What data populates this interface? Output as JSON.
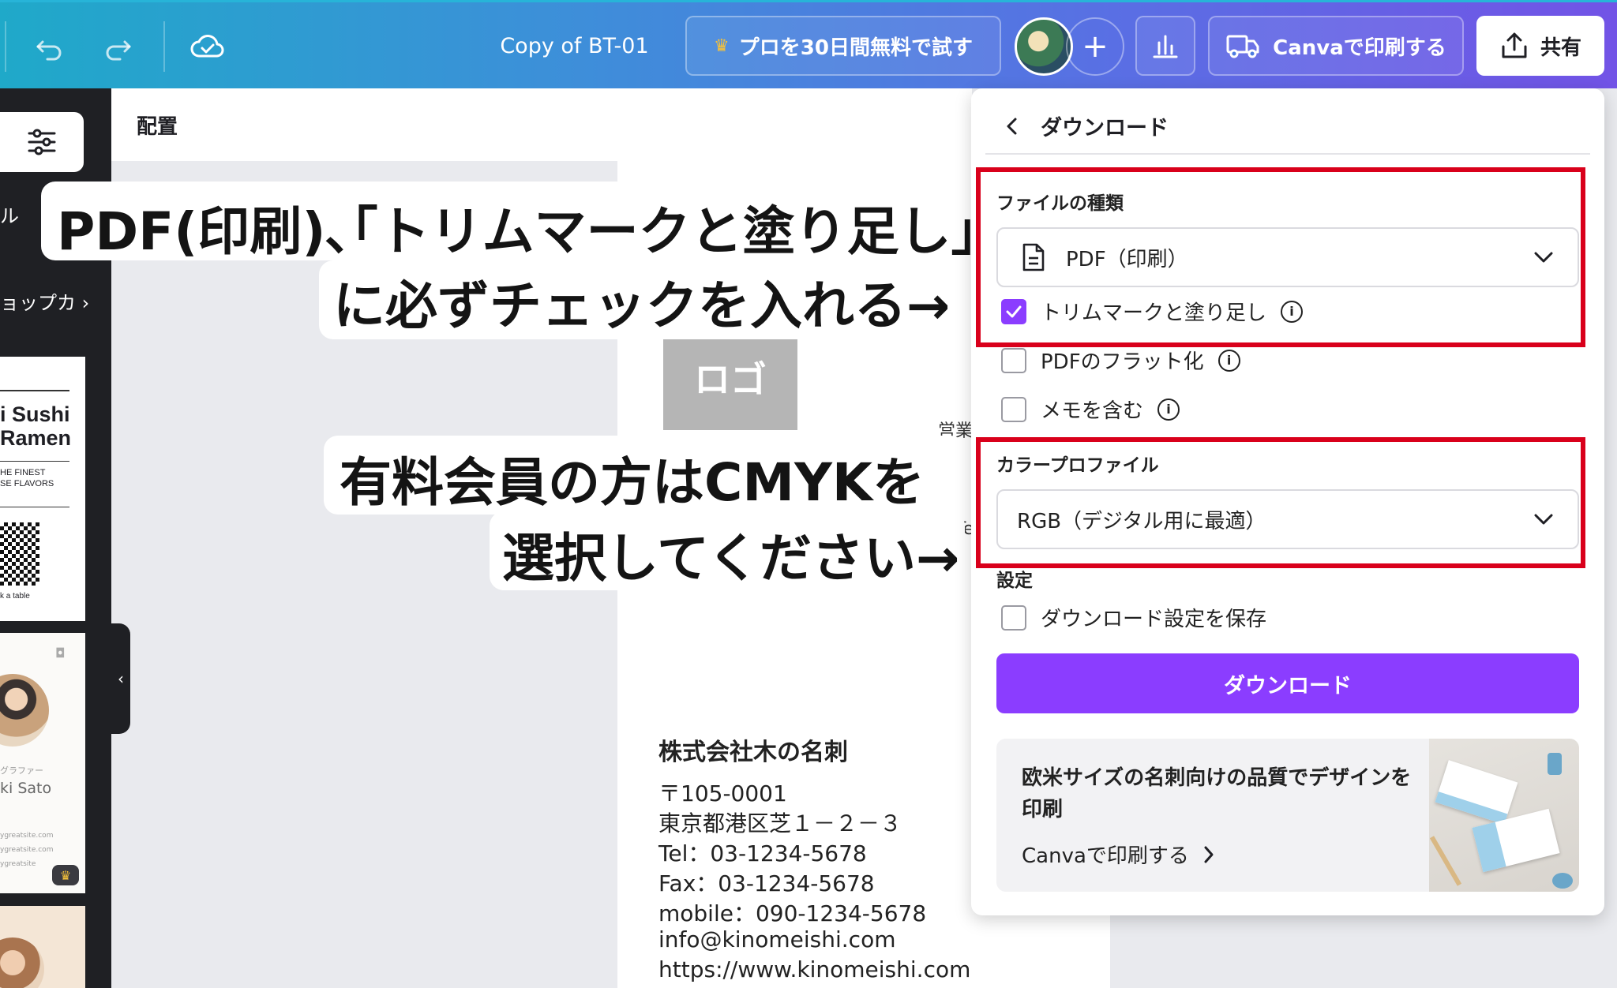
{
  "topbar": {
    "document_title": "Copy of BT-01",
    "pro_trial_label": "プロを30日間無料で試す",
    "print_label": "Canvaで印刷する",
    "share_label": "共有",
    "plus": "+"
  },
  "left_panel": {
    "partial_label_1": "ル",
    "partial_label_2": "ョップカ",
    "thumb1": {
      "line1": "i Sushi",
      "line2": "Ramen",
      "line3": "HE FINEST",
      "line4": "SE FLAVORS",
      "line5": "k a table"
    },
    "thumb2": {
      "line1": "グラファー",
      "line2": "ki Sato",
      "line3": "ygreatsite.com",
      "line4": "ygreatsite.com",
      "line5": "ygreatsite"
    }
  },
  "editor": {
    "header_label": "配置",
    "logo_placeholder": "ロゴ",
    "fragment_1": "営業",
    "fragment_2": "Te",
    "company_name": "株式会社木の名刺",
    "address_lines": [
      "〒105-0001",
      "東京都港区芝１－２－３",
      "Tel：03-1234-5678",
      "Fax：03-1234-5678",
      "mobile：090-1234-5678",
      "info@kinomeishi.com",
      "https://www.kinomeishi.com"
    ]
  },
  "annotations": {
    "note1_line1": "PDF(印刷)､｢トリムマークと塗り足し｣",
    "note1_line2": "に必ずチェックを入れる→",
    "note2_line1": "有料会員の方はCMYKを",
    "note2_line2": "選択してください→"
  },
  "download_panel": {
    "title": "ダウンロード",
    "file_type_label": "ファイルの種類",
    "file_type_value": "PDF（印刷）",
    "options": [
      {
        "label": "トリムマークと塗り足し",
        "checked": true
      },
      {
        "label": "PDFのフラット化",
        "checked": false
      },
      {
        "label": "メモを含む",
        "checked": false
      }
    ],
    "color_profile_label": "カラープロファイル",
    "color_profile_value": "RGB（デジタル用に最適）",
    "settings_label": "設定",
    "save_settings_label": "ダウンロード設定を保存",
    "download_button": "ダウンロード",
    "promo_title": "欧米サイズの名刺向けの品質でデザインを印刷",
    "promo_link": "Canvaで印刷する"
  },
  "colors": {
    "accent_purple": "#8b3dff",
    "highlight_red": "#d9001b",
    "topbar_start": "#1fa9c9",
    "topbar_end": "#7253e6"
  }
}
